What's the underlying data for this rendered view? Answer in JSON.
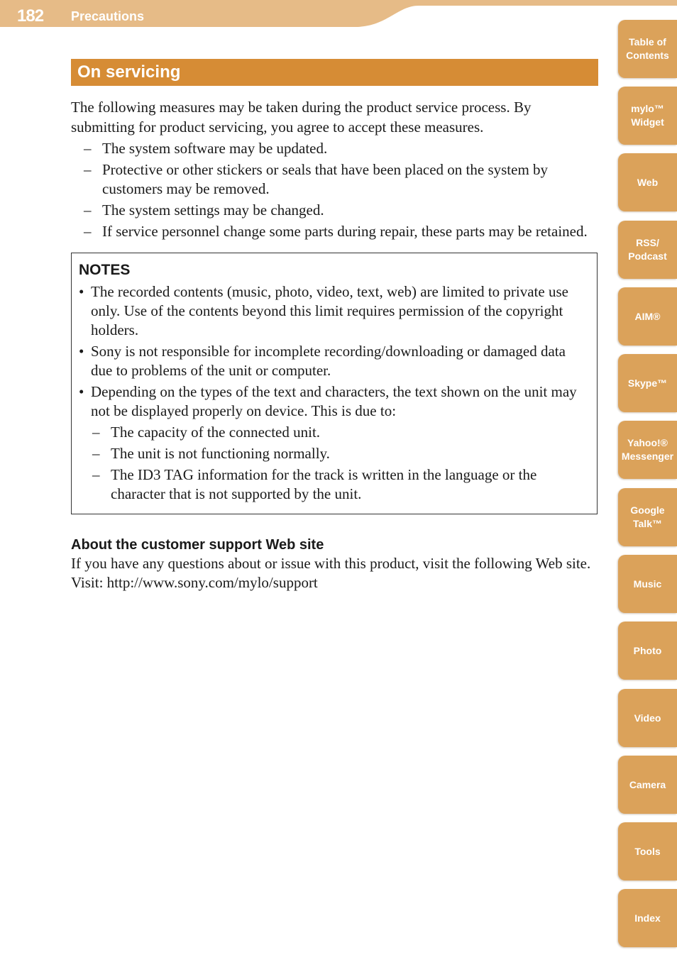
{
  "header": {
    "page_number": "182",
    "section": "Precautions",
    "band_color": "#e6bb87"
  },
  "main": {
    "title": "On servicing",
    "title_color": "#d68c35",
    "intro": "The following measures may be taken during the product service process. By submitting for product servicing, you agree to accept these measures.",
    "measures": [
      "The system software may be updated.",
      "Protective or other stickers or seals that have been placed on the system by customers may be removed.",
      "The system settings may be changed.",
      "If service personnel change some parts during repair, these parts may be retained."
    ],
    "notes": {
      "title": "NOTES",
      "items": [
        {
          "text": "The recorded contents (music, photo, video, text, web) are limited to private use only. Use of the contents beyond this limit requires permission of the copyright holders."
        },
        {
          "text": "Sony is not responsible for incomplete recording/downloading or damaged data due to problems of the unit or computer."
        },
        {
          "text": "Depending on the types of the text and characters, the text shown on the unit may not be displayed properly on device. This is due to:",
          "sub_items": [
            "The capacity of the connected unit.",
            "The unit is not functioning normally.",
            "The ID3 TAG information for the track is written in the language or the character that is not supported by the unit."
          ]
        }
      ]
    },
    "support": {
      "heading": "About the customer support Web site",
      "text": "If you have any questions about or issue with this product, visit the following Web site.",
      "visit": "Visit: http://www.sony.com/mylo/support"
    }
  },
  "symbols": {
    "dash": "–",
    "bullet": "•"
  },
  "side_nav": {
    "tab_color": "#dba25a",
    "tabs": [
      {
        "label": "Table of\nContents",
        "icon": "none"
      },
      {
        "label": "mylo™\nWidget"
      },
      {
        "label": "Web"
      },
      {
        "label": "RSS/\nPodcast"
      },
      {
        "label": "AIM®"
      },
      {
        "label": "Skype™"
      },
      {
        "label": "Yahoo!®\nMessenger"
      },
      {
        "label": "Google\nTalk™"
      },
      {
        "label": "Music"
      },
      {
        "label": "Photo"
      },
      {
        "label": "Video"
      },
      {
        "label": "Camera"
      },
      {
        "label": "Tools"
      },
      {
        "label": "Index"
      }
    ]
  }
}
